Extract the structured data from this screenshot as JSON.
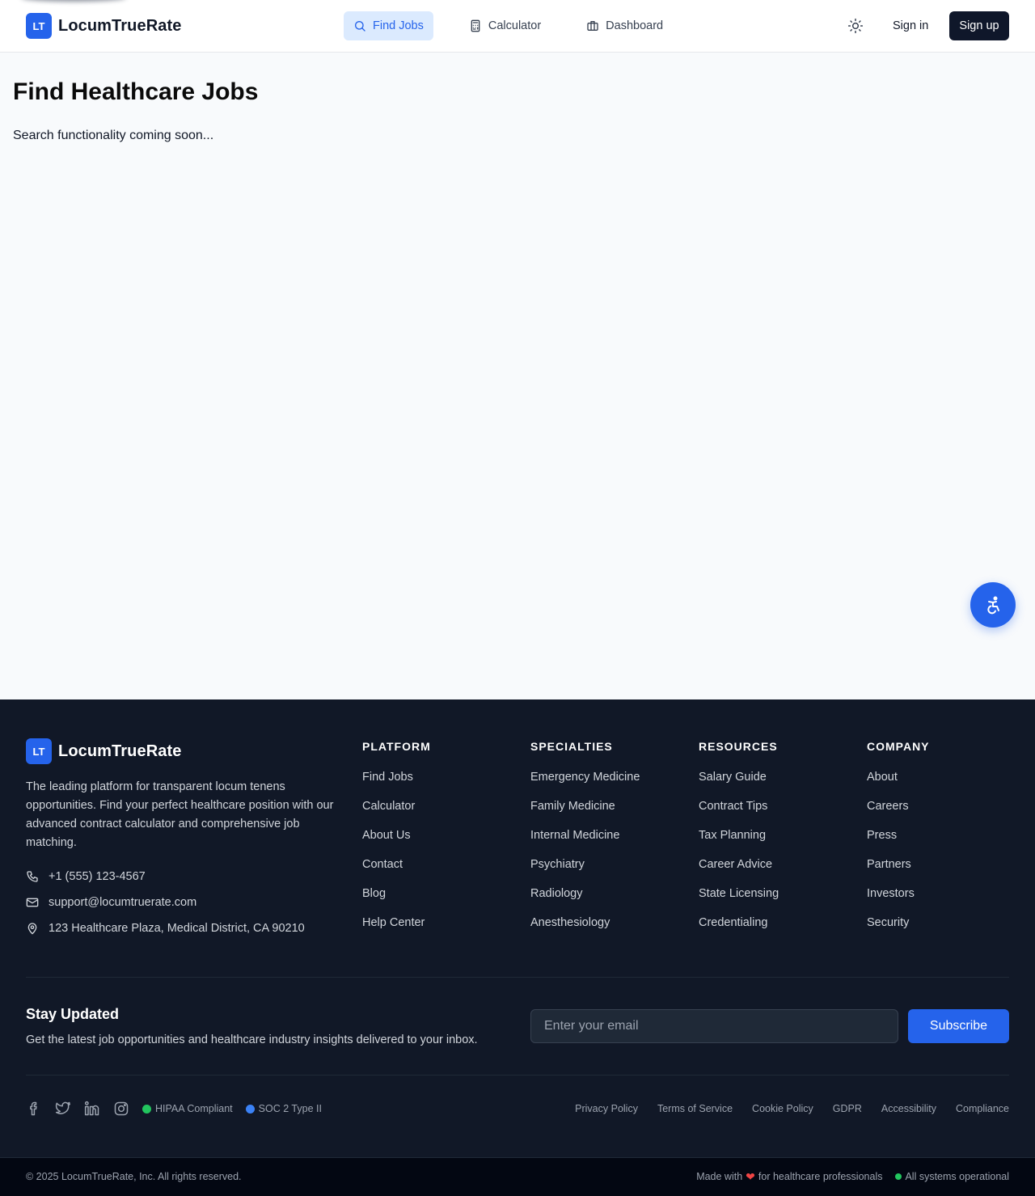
{
  "brand": {
    "logo_text": "LT",
    "name": "LocumTrueRate"
  },
  "nav": {
    "items": [
      {
        "label": "Find Jobs",
        "icon": "search-icon",
        "active": true
      },
      {
        "label": "Calculator",
        "icon": "calculator-icon",
        "active": false
      },
      {
        "label": "Dashboard",
        "icon": "briefcase-icon",
        "active": false
      }
    ],
    "theme_icon": "sun-icon",
    "sign_in": "Sign in",
    "sign_up": "Sign up"
  },
  "main": {
    "title": "Find Healthcare Jobs",
    "subtitle": "Search functionality coming soon..."
  },
  "accessibility_button_icon": "accessibility-icon",
  "footer": {
    "description": "The leading platform for transparent locum tenens opportunities. Find your perfect healthcare position with our advanced contract calculator and comprehensive job matching.",
    "contact": {
      "phone": "+1 (555) 123-4567",
      "email": "support@locumtruerate.com",
      "address": "123 Healthcare Plaza, Medical District, CA 90210"
    },
    "columns": [
      {
        "heading": "PLATFORM",
        "links": [
          "Find Jobs",
          "Calculator",
          "About Us",
          "Contact",
          "Blog",
          "Help Center"
        ]
      },
      {
        "heading": "SPECIALTIES",
        "links": [
          "Emergency Medicine",
          "Family Medicine",
          "Internal Medicine",
          "Psychiatry",
          "Radiology",
          "Anesthesiology"
        ]
      },
      {
        "heading": "RESOURCES",
        "links": [
          "Salary Guide",
          "Contract Tips",
          "Tax Planning",
          "Career Advice",
          "State Licensing",
          "Credentialing"
        ]
      },
      {
        "heading": "COMPANY",
        "links": [
          "About",
          "Careers",
          "Press",
          "Partners",
          "Investors",
          "Security"
        ]
      }
    ],
    "newsletter": {
      "title": "Stay Updated",
      "subtitle": "Get the latest job opportunities and healthcare industry insights delivered to your inbox.",
      "placeholder": "Enter your email",
      "button": "Subscribe"
    },
    "social_icons": [
      "facebook-icon",
      "twitter-icon",
      "linkedin-icon",
      "instagram-icon"
    ],
    "badges": [
      {
        "label": "HIPAA Compliant",
        "color": "#22c55e"
      },
      {
        "label": "SOC 2 Type II",
        "color": "#3b82f6"
      }
    ],
    "legal_links": [
      "Privacy Policy",
      "Terms of Service",
      "Cookie Policy",
      "GDPR",
      "Accessibility",
      "Compliance"
    ],
    "copyright": "© 2025 LocumTrueRate, Inc. All rights reserved.",
    "made_with_prefix": "Made with",
    "made_with_suffix": "for healthcare professionals",
    "status": "All systems operational"
  },
  "colors": {
    "accent": "#2563eb",
    "footer_bg": "#111827",
    "page_bg": "#f8fafc"
  }
}
